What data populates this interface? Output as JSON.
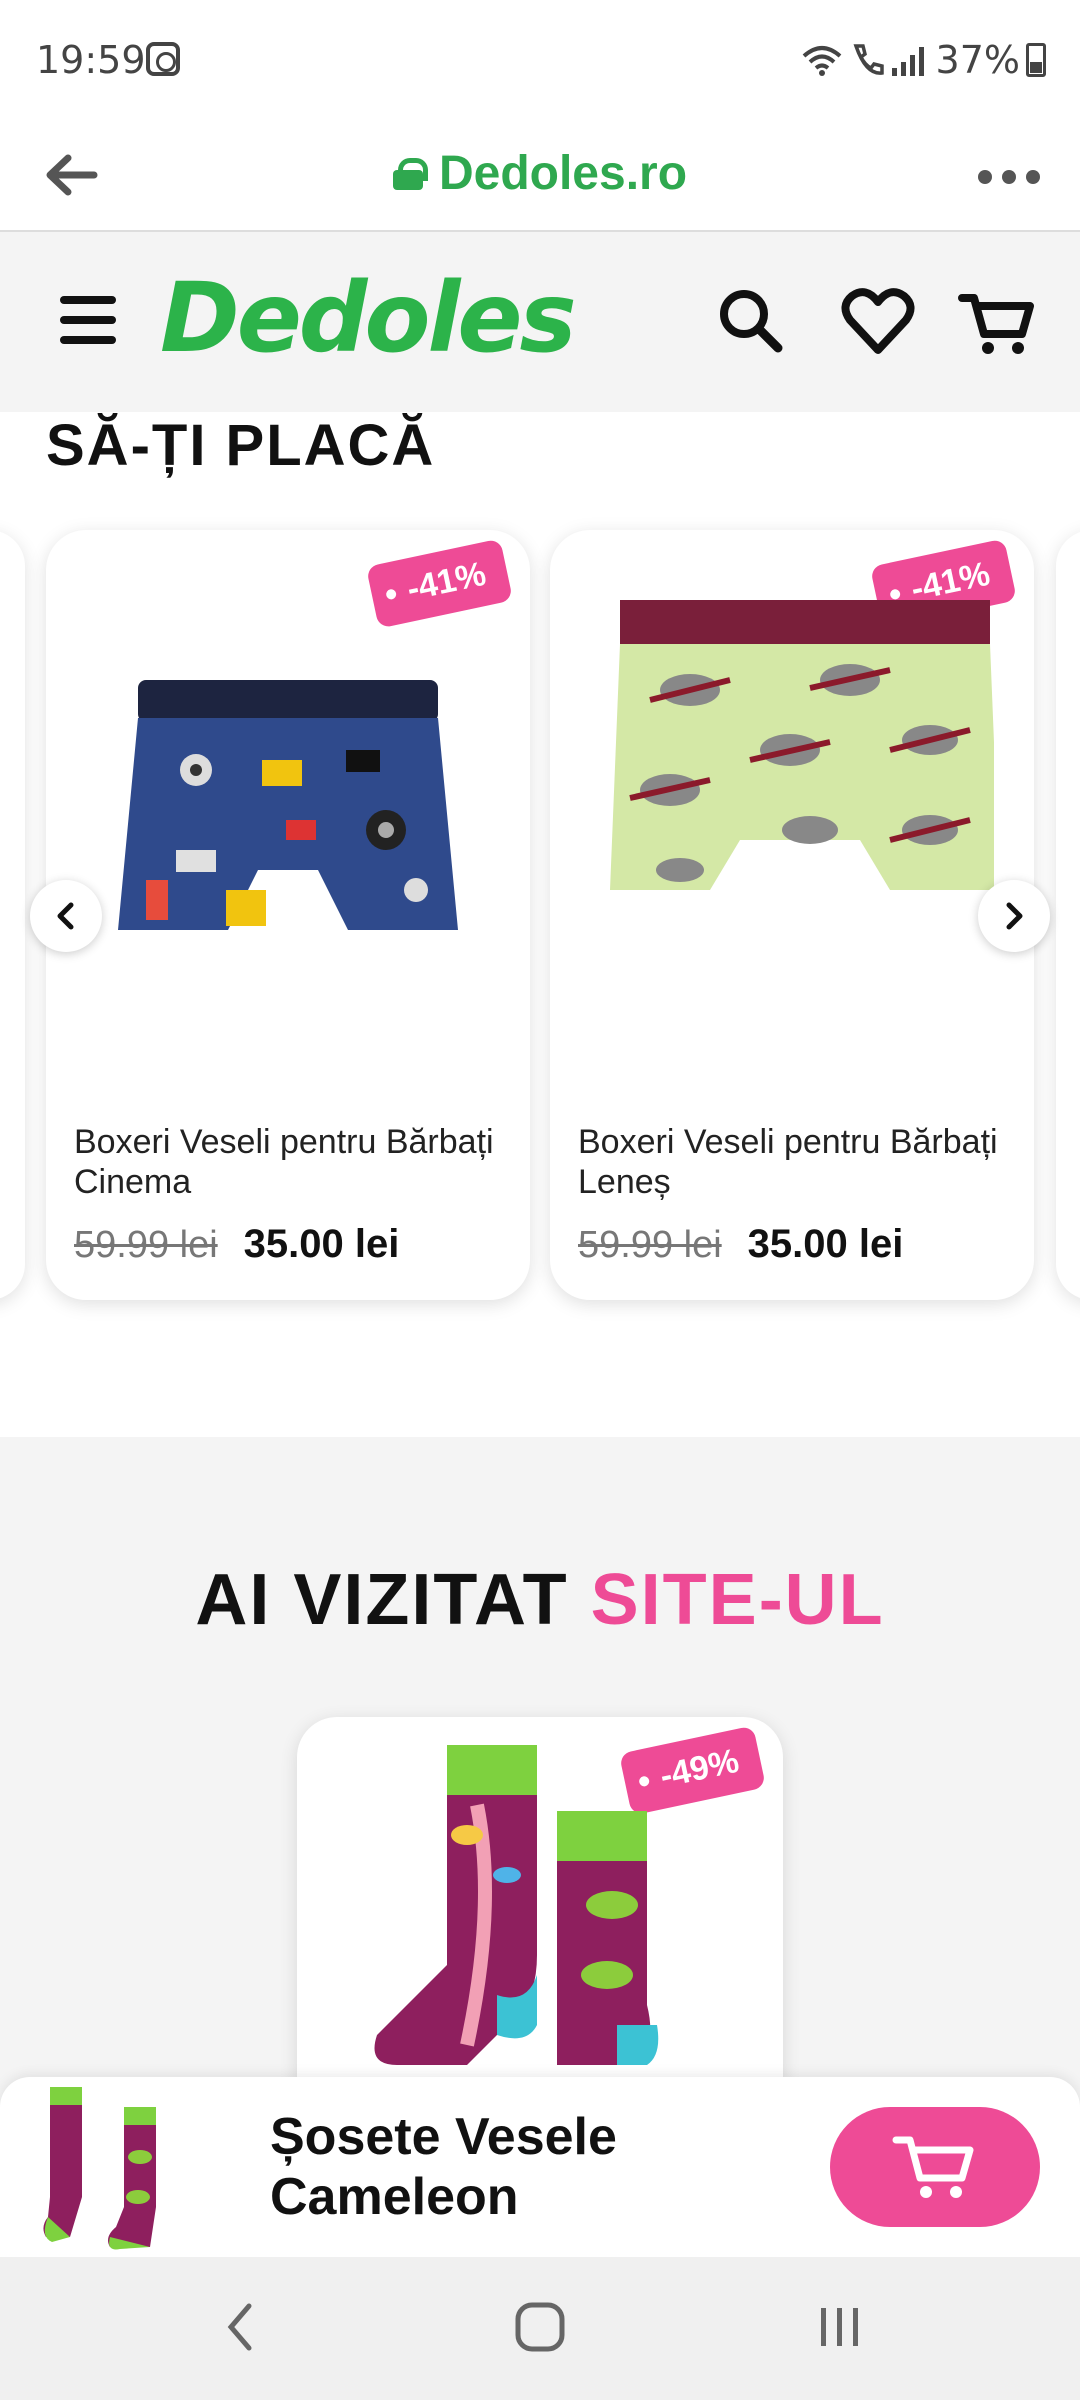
{
  "status_bar": {
    "time": "19:59",
    "battery": "37%"
  },
  "browser": {
    "url": "Dedoles.ro"
  },
  "header": {
    "logo": "Dedoles"
  },
  "recommended": {
    "title": "SĂ-ȚI PLACĂ",
    "products": [
      {
        "name": "Boxeri Veseli pentru Bărbați Cinema",
        "old_price": "59.99 lei",
        "price": "35.00 lei",
        "discount": "-41%"
      },
      {
        "name": "Boxeri Veseli pentru Bărbați Leneș",
        "old_price": "59.99 lei",
        "price": "35.00 lei",
        "discount": "-41%"
      }
    ]
  },
  "visited": {
    "title_main": "AI VIZITAT",
    "title_accent": "SITE-UL",
    "product": {
      "discount": "-49%"
    }
  },
  "bottom_bar": {
    "product_name": "Șosete Vesele Cameleon"
  },
  "colors": {
    "brand_green": "#2cb34a",
    "accent_pink": "#ee4b96"
  }
}
